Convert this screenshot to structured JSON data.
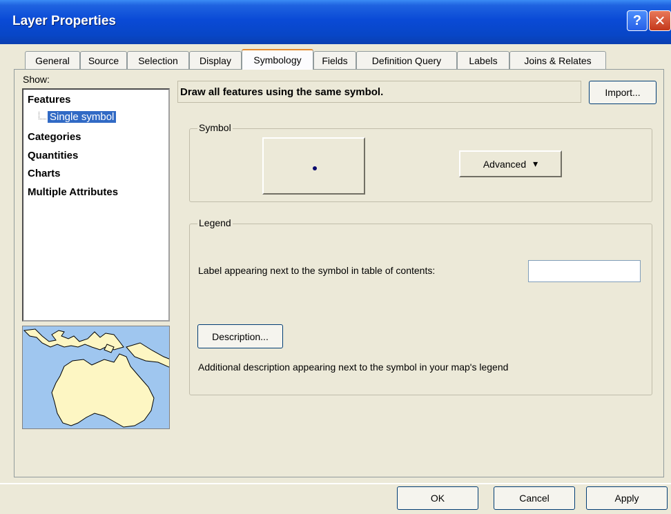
{
  "window": {
    "title": "Layer Properties",
    "help_glyph": "?",
    "close_glyph": "✕"
  },
  "tabs": [
    {
      "label": "General",
      "active": false
    },
    {
      "label": "Source",
      "active": false
    },
    {
      "label": "Selection",
      "active": false
    },
    {
      "label": "Display",
      "active": false
    },
    {
      "label": "Symbology",
      "active": true
    },
    {
      "label": "Fields",
      "active": false
    },
    {
      "label": "Definition Query",
      "active": false
    },
    {
      "label": "Labels",
      "active": false
    },
    {
      "label": "Joins & Relates",
      "active": false
    }
  ],
  "show": {
    "label": "Show:",
    "items": [
      "Features",
      "Categories",
      "Quantities",
      "Charts",
      "Multiple Attributes"
    ],
    "selected_subitem": "Single symbol"
  },
  "symbology": {
    "description": "Draw all features using the same symbol.",
    "import_label": "Import...",
    "symbol_group_label": "Symbol",
    "symbol_color": "#0a0a6e",
    "advanced_label": "Advanced",
    "advanced_arrow": "▾"
  },
  "legend": {
    "group_label": "Legend",
    "label_prompt": "Label appearing next to the symbol in table of contents:",
    "label_value": "",
    "description_button": "Description...",
    "description_text": "Additional description appearing next to the symbol in your map's legend"
  },
  "footer": {
    "ok": "OK",
    "cancel": "Cancel",
    "apply": "Apply"
  },
  "colors": {
    "title_bar": "#0a4ad6",
    "selection": "#316ac5",
    "map_water": "#9fc6ef",
    "map_land": "#fdf6c3",
    "tab_active_accent": "#e68b2c"
  }
}
